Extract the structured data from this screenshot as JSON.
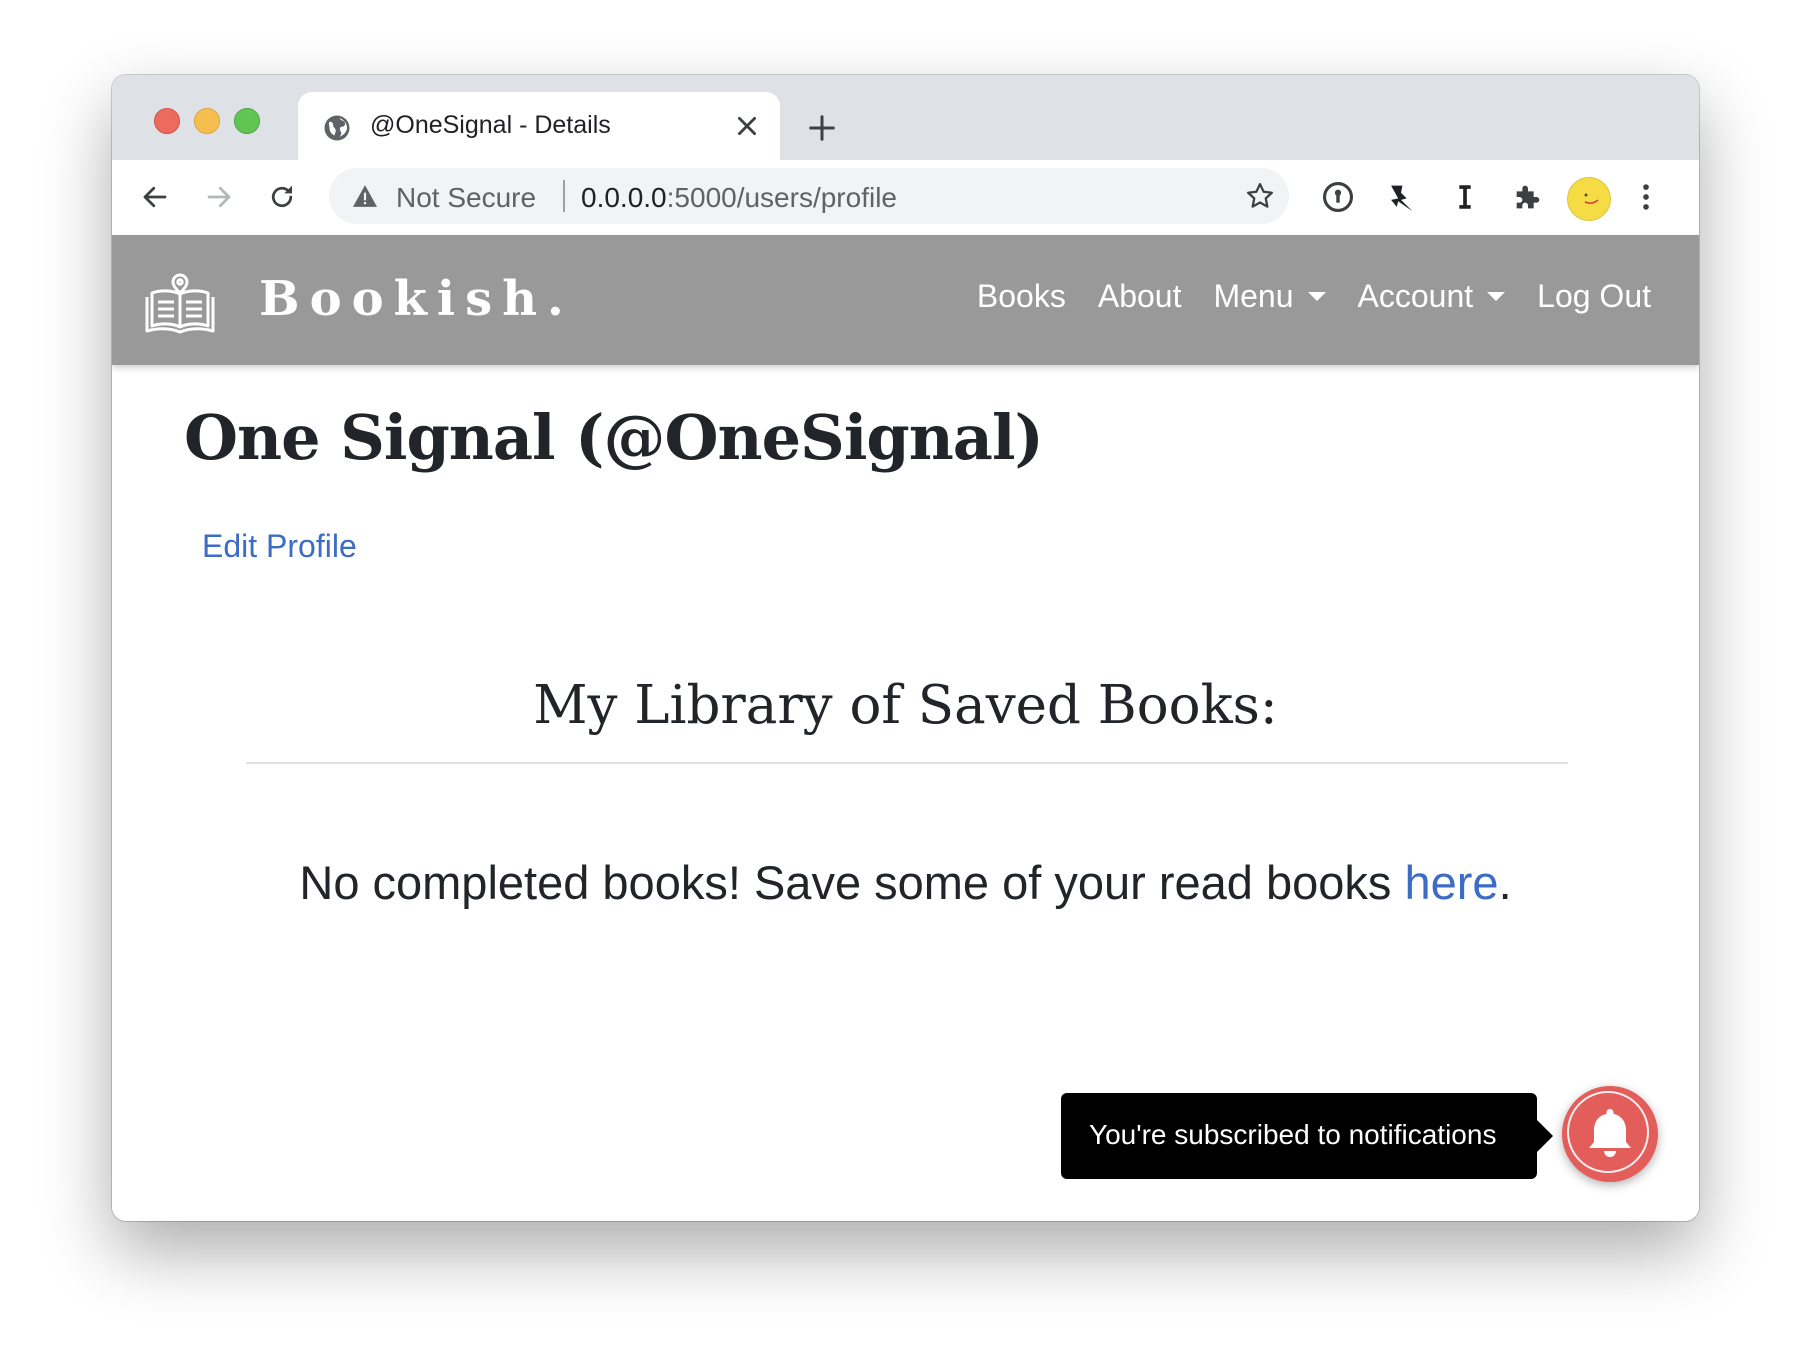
{
  "browser": {
    "tab": {
      "title": "@OneSignal - Details",
      "icon": "globe-icon",
      "close_icon": "close-icon"
    },
    "new_tab_icon": "plus-icon",
    "address_bar": {
      "security_label": "Not Secure",
      "url_host": "0.0.0.0",
      "url_path": ":5000/users/profile"
    },
    "extensions": [
      "password-manager-icon",
      "pin-icon",
      "instapaper-icon",
      "puzzle-icon",
      "profile-avatar",
      "kebab-menu-icon"
    ]
  },
  "navbar": {
    "brand": "Bookish.",
    "links": [
      {
        "label": "Books"
      },
      {
        "label": "About"
      },
      {
        "label": "Menu",
        "dropdown": true
      },
      {
        "label": "Account",
        "dropdown": true
      },
      {
        "label": "Log Out"
      }
    ]
  },
  "profile": {
    "title": "One Signal (@OneSignal)",
    "edit_link": "Edit Profile"
  },
  "library": {
    "heading": "My Library of Saved Books:",
    "empty_prefix": "No completed books! Save some of your read books ",
    "empty_link": "here",
    "empty_suffix": "."
  },
  "notification": {
    "tooltip": "You're subscribed to notifications",
    "button_color": "#e35d5b",
    "icon": "bell-icon"
  },
  "colors": {
    "navbar_bg": "#999999",
    "link": "#3c6cc4",
    "text": "#212529"
  }
}
